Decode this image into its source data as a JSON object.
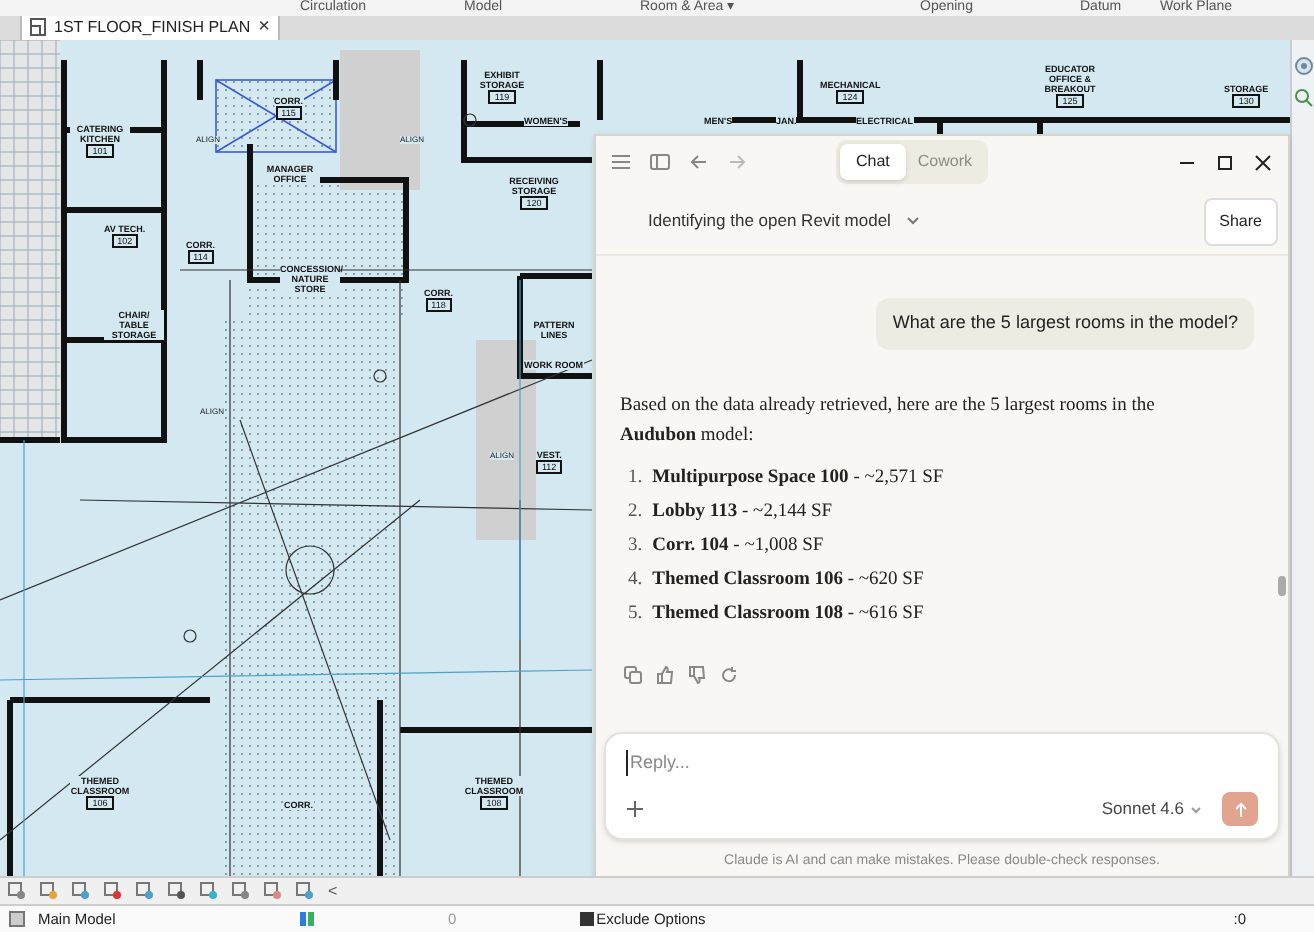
{
  "ribbon_panels": [
    "Circulation",
    "Model",
    "Room & Area ▾",
    "Opening",
    "Datum",
    "Work Plane"
  ],
  "view_tab": {
    "title": "1ST FLOOR_FINISH PLAN",
    "close": "×"
  },
  "plan": {
    "rooms": [
      {
        "name": "CATERING KITCHEN",
        "number": "101"
      },
      {
        "name": "CORR.",
        "number": "115"
      },
      {
        "name": "EXHIBIT STORAGE",
        "number": "119"
      },
      {
        "name": "WOMEN'S"
      },
      {
        "name": "MEN'S"
      },
      {
        "name": "JAN."
      },
      {
        "name": "ELECTRICAL"
      },
      {
        "name": "MECHANICAL",
        "number": "124"
      },
      {
        "name": "EDUCATOR OFFICE & BREAKOUT",
        "number": "125"
      },
      {
        "name": "STORAGE",
        "number": "130"
      },
      {
        "name": "MANAGER OFFICE"
      },
      {
        "name": "AV TECH.",
        "number": "102"
      },
      {
        "name": "CORR.",
        "number": "114"
      },
      {
        "name": "CONCESSION/ NATURE STORE"
      },
      {
        "name": "CHAIR/ TABLE STORAGE"
      },
      {
        "name": "CORR.",
        "number": "118"
      },
      {
        "name": "RECEIVING STORAGE",
        "number": "120"
      },
      {
        "name": "PATTERN LINES"
      },
      {
        "name": "WORK ROOM"
      },
      {
        "name": "VEST.",
        "number": "112"
      },
      {
        "name": "THEMED CLASSROOM",
        "number": "106"
      },
      {
        "name": "CORR."
      },
      {
        "name": "THEMED CLASSROOM",
        "number": "108"
      }
    ],
    "notes": [
      "ALIGN",
      "ALIGN",
      "ALIGN",
      "ALIGN"
    ]
  },
  "chat": {
    "tabs": [
      {
        "label": "Chat",
        "selected": true
      },
      {
        "label": "Cowork",
        "selected": false
      }
    ],
    "conversation_title": "Identifying the open Revit model",
    "share": "Share",
    "user_message": "What are the 5 largest rooms in the model?",
    "response_intro": "Based on the data already retrieved, here are the 5 largest rooms in the **Audubon** model:",
    "response_items": [
      {
        "marker": "1.",
        "text": "**Multipurpose Space 100** - ~2,571 SF"
      },
      {
        "marker": "2.",
        "text": "**Lobby 113** - ~2,144 SF"
      },
      {
        "marker": "3.",
        "text": "**Corr. 104** - ~1,008 SF"
      },
      {
        "marker": "4.",
        "text": "**Themed Classroom 106** - ~620 SF"
      },
      {
        "marker": "5.",
        "text": "**Themed Classroom 108** - ~616 SF"
      }
    ],
    "input": {
      "placeholder": "Reply..."
    },
    "model": "Sonnet 4.6",
    "disclaimer": "Claude is AI and can make mistakes. Please double-check responses."
  },
  "view_control_bar": {
    "collapse": "<"
  },
  "status_bar": {
    "model": "Main Model",
    "exclude_options": {
      "label": "Exclude Options",
      "checked": true
    },
    "worksets_count": "0",
    "filter_count": ":0"
  }
}
